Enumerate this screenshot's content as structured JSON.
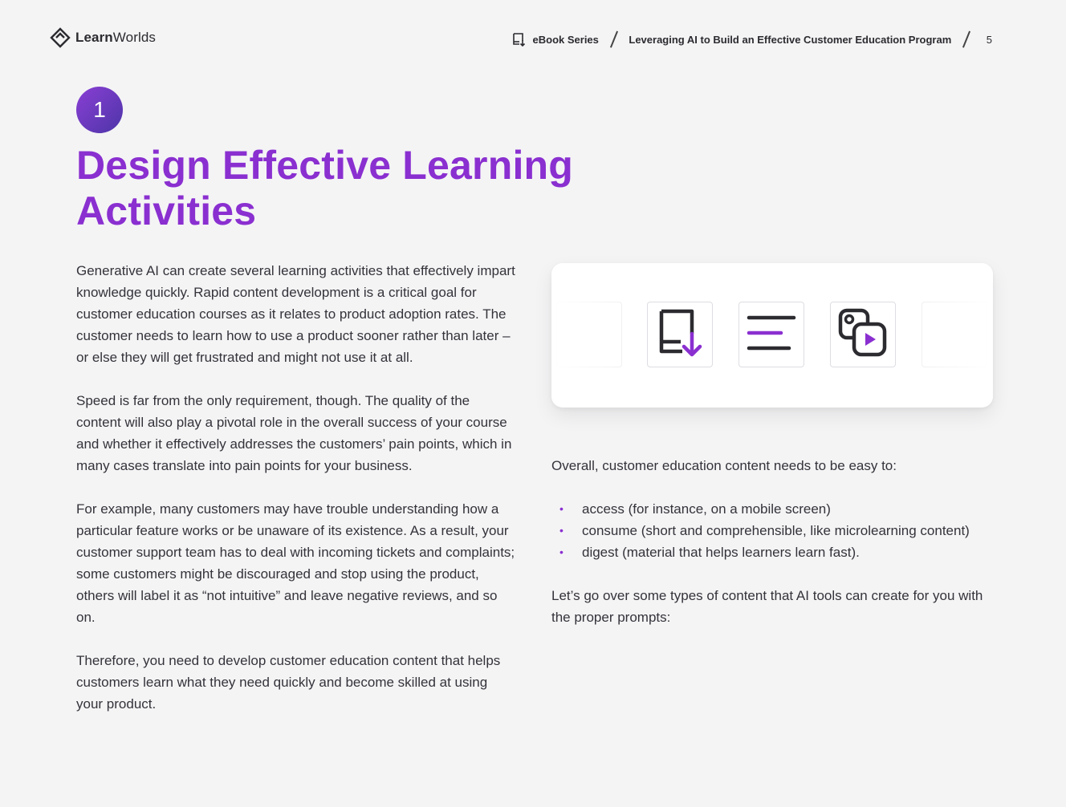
{
  "header": {
    "logo": {
      "bold": "Learn",
      "regular": "Worlds",
      "icon": "learnworlds-diamond-icon"
    },
    "breadcrumb": {
      "series": "eBook Series",
      "title": "Leveraging AI to Build an Effective Customer Education Program",
      "page": "5",
      "series_icon": "ebook-icon"
    }
  },
  "section": {
    "number": "1",
    "title": "Design Effective Learning Activities"
  },
  "left_column": {
    "paragraphs": [
      "Generative AI can create several learning activities that effectively impart knowledge quickly. Rapid content development is a critical goal for customer education courses as it relates to product adoption rates. The customer needs to learn how to use a product sooner rather than later – or else they will get frustrated and might not use it at all.",
      "Speed is far from the only requirement, though. The quality of the content will also play a pivotal role in the overall success of your course and whether it effectively addresses the customers’ pain points, which in many cases translate into pain points for your business.",
      "For example, many customers may have trouble understanding how a particular feature works or be unaware of its existence. As a result, your customer support team has to deal with incoming tickets and complaints; some customers might be discouraged and stop using the product, others will label it as “not intuitive” and leave negative reviews, and so on.",
      "Therefore, you need to develop customer education content that helps customers learn what they need quickly and become skilled at using your product."
    ]
  },
  "illustration": {
    "icons": [
      "ebook-download-icon",
      "text-lines-icon",
      "media-video-icon"
    ]
  },
  "right_column": {
    "intro": "Overall, customer education content needs to be easy to:",
    "bullet_symbol": "•",
    "bullets": [
      "access (for instance, on a mobile screen)",
      "consume (short and comprehensible, like microlearning content)",
      "digest (material that helps learners learn fast)."
    ],
    "outro": "Let’s go over some types of content that AI tools can create for you with the proper prompts:"
  },
  "colors": {
    "accent": "#8a2fd0",
    "badge_start": "#8a3fd4",
    "badge_end": "#4d35a8",
    "background": "#f4f4f5",
    "text": "#33333a"
  }
}
